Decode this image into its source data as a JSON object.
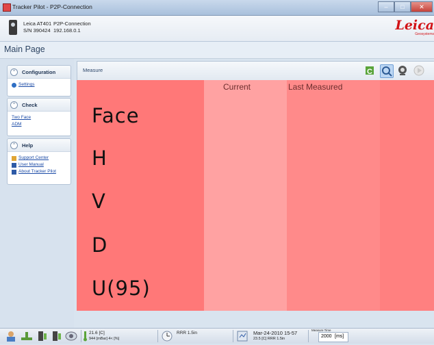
{
  "window": {
    "title": "Tracker Pilot - P2P-Connection",
    "controls": {
      "minimize": "–",
      "maximize": "□",
      "close": "✕"
    }
  },
  "device": {
    "model": "Leica AT401",
    "serial": "S/N 390424",
    "connection": "P2P-Connection",
    "ip": "192.168.0.1",
    "logo_text": "Leica",
    "logo_sub": "Geosystems"
  },
  "page": {
    "title": "Main Page"
  },
  "sidebar": {
    "groups": [
      {
        "title": "Configuration",
        "links": [
          "Settings"
        ]
      },
      {
        "title": "Check",
        "links": [
          "Two Face",
          "ADM"
        ]
      },
      {
        "title": "Help",
        "links": [
          "Support Center",
          "User Manual",
          "About Tracker Pilot"
        ]
      }
    ]
  },
  "measure": {
    "label": "Measure",
    "toolbar_icons": [
      "refresh-c-icon",
      "search-icon",
      "camera-icon",
      "play-icon"
    ],
    "columns": [
      "Current",
      "Last Measured"
    ],
    "rows": [
      "Face",
      "H",
      "V",
      "D",
      "U(95)"
    ]
  },
  "status": {
    "temperature": "21.6 [C]",
    "pressure_humidity": "944 [mBar]  4< [%]",
    "reflector": "RRR 1.5in",
    "datetime": "Mar-24-2010 15-57",
    "last_info": "23.5 [C] RRR 1.5in",
    "measure_time_label": "Measure Time",
    "measure_time_value": "2000",
    "measure_time_unit": "[ms]"
  },
  "colors": {
    "grid_label": "#ff7878",
    "grid_current": "#ffa2a2",
    "grid_last": "#ff8a8a",
    "leica_red": "#d21317"
  }
}
